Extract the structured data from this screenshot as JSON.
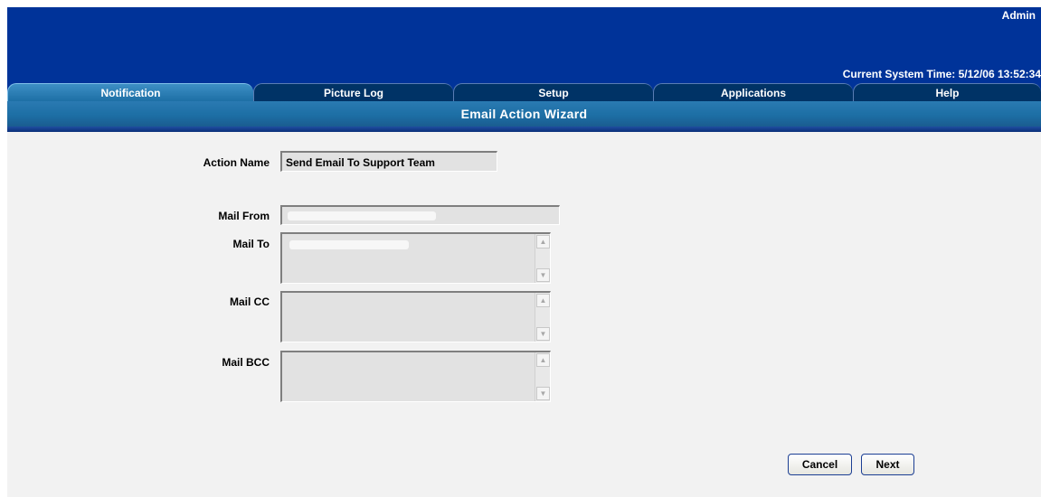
{
  "header": {
    "user": "Admin",
    "system_time": "Current System Time: 5/12/06 13:52:34"
  },
  "tabs": [
    {
      "label": "Notification",
      "active": true
    },
    {
      "label": "Picture Log",
      "active": false
    },
    {
      "label": "Setup",
      "active": false
    },
    {
      "label": "Applications",
      "active": false
    },
    {
      "label": "Help",
      "active": false
    }
  ],
  "wizard": {
    "title": "Email Action Wizard"
  },
  "form": {
    "action_name_label": "Action Name",
    "action_name_value": "Send Email To Support Team",
    "mail_from_label": "Mail From",
    "mail_from_value": "",
    "mail_to_label": "Mail To",
    "mail_to_value": "",
    "mail_cc_label": "Mail CC",
    "mail_cc_value": "",
    "mail_bcc_label": "Mail BCC",
    "mail_bcc_value": ""
  },
  "buttons": {
    "cancel": "Cancel",
    "next": "Next"
  },
  "colors": {
    "header_bg": "#003399",
    "tab_active": "#2a7ab2",
    "content_bg": "#f2f2f2",
    "field_bg": "#e2e2e2"
  }
}
